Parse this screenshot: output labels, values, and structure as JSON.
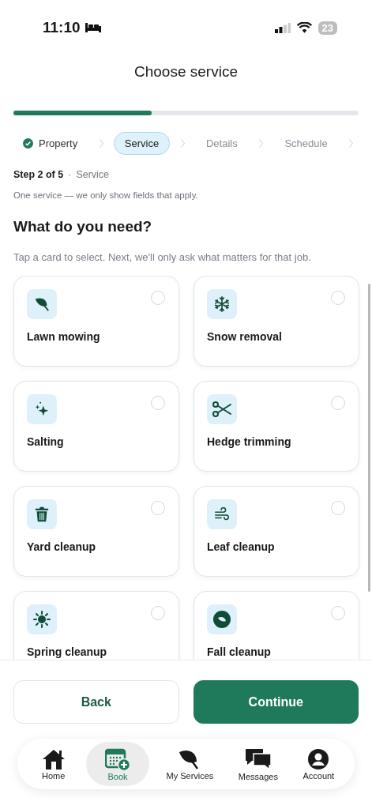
{
  "status_bar": {
    "time": "11:10",
    "battery": "23"
  },
  "title": "Choose service",
  "progress": {
    "level": 0.4
  },
  "steps": [
    {
      "label": "Property",
      "completed": true,
      "selected": false
    },
    {
      "label": "Service",
      "completed": false,
      "selected": true
    },
    {
      "label": "Details",
      "completed": false,
      "selected": false
    },
    {
      "label": "Schedule",
      "completed": false,
      "selected": false
    }
  ],
  "step_info": {
    "step": "Step 2 of 5",
    "separator": "·",
    "name": "Service"
  },
  "note": "One service — we only show fields that apply.",
  "heading": "What do you need?",
  "hint": "Tap a card to select. Next, we'll only ask what matters for that job.",
  "services": [
    {
      "label": "Lawn mowing",
      "kind": "leaf",
      "selected": false
    },
    {
      "label": "Snow removal",
      "kind": "snowflake",
      "selected": false
    },
    {
      "label": "Salting",
      "kind": "sparkles",
      "selected": false
    },
    {
      "label": "Hedge trimming",
      "kind": "scissors",
      "selected": false
    },
    {
      "label": "Yard cleanup",
      "kind": "trash",
      "selected": false
    },
    {
      "label": "Leaf cleanup",
      "kind": "wind",
      "selected": false
    },
    {
      "label": "Spring cleanup",
      "kind": "sun",
      "selected": false
    },
    {
      "label": "Fall cleanup",
      "kind": "leafcircle",
      "selected": false
    }
  ],
  "buttons": [
    {
      "label": "Back",
      "kind": "secondary"
    },
    {
      "label": "Continue",
      "kind": "primary"
    }
  ],
  "nav": [
    {
      "label": "Home",
      "kind": "home",
      "selected": false
    },
    {
      "label": "Book",
      "kind": "book",
      "selected": true
    },
    {
      "label": "My Services",
      "kind": "leaf",
      "selected": false
    },
    {
      "label": "Messages",
      "kind": "messages",
      "selected": false
    },
    {
      "label": "Account",
      "kind": "account",
      "selected": false
    }
  ]
}
